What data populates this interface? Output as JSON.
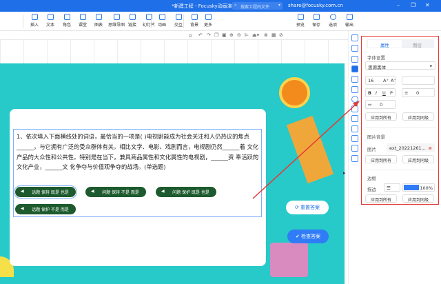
{
  "titlebar": {
    "title": "*新建工程 - Focusky动画演示大师  v4.6.100",
    "search_placeholder": "搜索工程内文件",
    "email": "share@focusky.com.cn"
  },
  "toolbar": {
    "items": [
      "插入",
      "文本",
      "角色",
      "课堂",
      "图表",
      "思维导图",
      "链接",
      "幻灯片",
      "动画",
      "交互",
      "背景",
      "更多"
    ],
    "right": [
      "预览",
      "保存",
      "选项",
      "输出"
    ]
  },
  "question": {
    "text": "1、依次填入下面横线处的词语，最恰当的一项是( )电视剧能成为社会关注和人仍热议的焦点______，与它拥有广泛的受众群体有关。相比文学、电影、戏剧而言，电视剧仍然______着 文化产品的大众性和公共性。特别是在当下，兼具商品属性和文化属性的电视剧，______资 奉活跃的文化产业，______文 化争夺与价值观争夺的战场。(单选题)",
    "options": [
      "话题 保持 既是 也是",
      "问题 保持 不是 而是",
      "问题 保护 既是 也是",
      "话题 保护 不是 而是"
    ],
    "reset": "重置答案",
    "check": "检查答案"
  },
  "panel": {
    "tabs": [
      "属性",
      "图层"
    ],
    "font_section": "字体设置",
    "font": "思源黑体",
    "size": "16",
    "line_spacing": "0",
    "letter_spacing": "0",
    "apply_all": "应用到所有",
    "apply_same": "应用到同级",
    "bg_section": "图片背景",
    "image_label": "图片",
    "image_value": "ext_20221261...",
    "border_section": "边框",
    "stroke_label": "描边",
    "opacity": "100%",
    "border_color": "#2f7cf6"
  }
}
